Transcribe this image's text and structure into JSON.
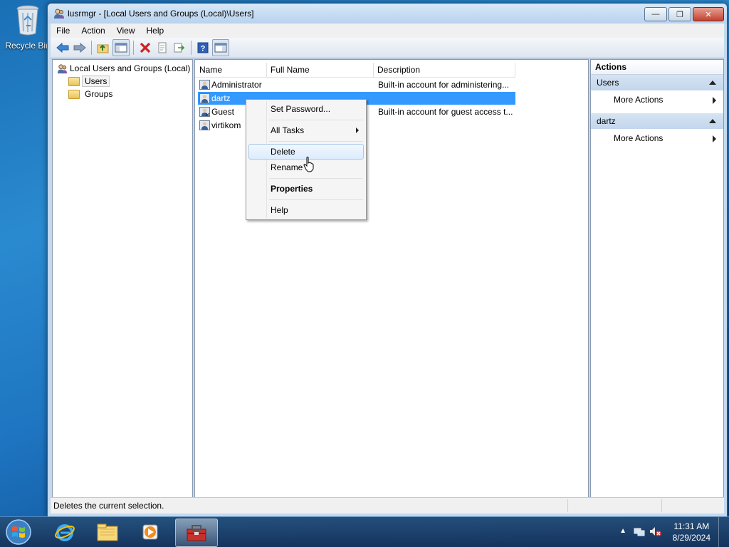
{
  "desktop": {
    "recycle_bin_label": "Recycle Bin"
  },
  "window": {
    "title": "lusrmgr - [Local Users and Groups (Local)\\Users]",
    "menu": [
      "File",
      "Action",
      "View",
      "Help"
    ]
  },
  "tree": {
    "root": "Local Users and Groups (Local)",
    "children": [
      "Users",
      "Groups"
    ],
    "selected": "Users"
  },
  "list": {
    "columns": [
      "Name",
      "Full Name",
      "Description"
    ],
    "rows": [
      {
        "name": "Administrator",
        "full_name": "",
        "description": "Built-in account for administering..."
      },
      {
        "name": "dartz",
        "full_name": "",
        "description": ""
      },
      {
        "name": "Guest",
        "full_name": "",
        "description": "Built-in account for guest access t..."
      },
      {
        "name": "virtikom",
        "full_name": "",
        "description": ""
      }
    ],
    "selected_row": "dartz"
  },
  "context_menu": {
    "items": [
      "Set Password...",
      "All Tasks",
      "Delete",
      "Rename",
      "Properties",
      "Help"
    ],
    "highlighted": "Delete"
  },
  "actions_pane": {
    "header": "Actions",
    "sections": [
      {
        "title": "Users",
        "item": "More Actions"
      },
      {
        "title": "dartz",
        "item": "More Actions"
      }
    ]
  },
  "status_bar": {
    "text": "Deletes the current selection."
  },
  "taskbar": {
    "time": "11:31 AM",
    "date": "8/29/2024"
  }
}
